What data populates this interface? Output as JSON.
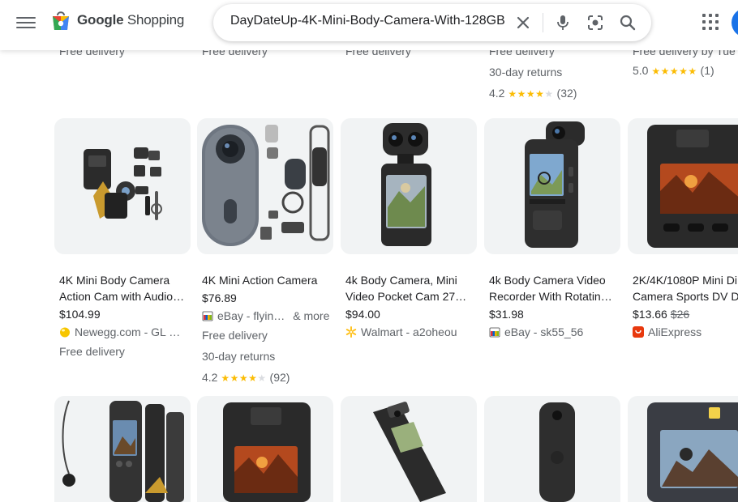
{
  "header": {
    "logo_word1": "Google",
    "logo_word2": "Shopping",
    "search_value": "DayDateUp-4K-Mini-Body-Camera-With-128GB",
    "icons": [
      "menu-icon",
      "shopping-bag-logo",
      "close-icon",
      "mic-icon",
      "lens-icon",
      "search-icon",
      "apps-grid-icon",
      "avatar"
    ]
  },
  "top_row": [
    {
      "line1": "Free delivery"
    },
    {
      "line1": "Free delivery"
    },
    {
      "line1": "Free delivery"
    },
    {
      "line1": "Free delivery",
      "line2": "30-day returns",
      "rating": "4.2",
      "stars": "★★★★",
      "star_empty": "★",
      "reviews": "(32)"
    },
    {
      "line1": "Free delivery by Tue",
      "rating": "5.0",
      "stars": "★★★★★",
      "reviews": "(1)"
    }
  ],
  "products": [
    {
      "title_l1": "4K Mini Body Camera",
      "title_l2": "Action Cam with Audio…",
      "price": "$104.99",
      "store": "Newegg.com - GL …",
      "store_icon": "newegg-icon",
      "extra1": "Free delivery"
    },
    {
      "title_l1": "4K Mini Action Camera",
      "title_l2": "",
      "price": "$76.89",
      "store": "eBay - flyin…",
      "store_icon": "ebay-icon",
      "more": "& more",
      "extra1": "Free delivery",
      "extra2": "30-day returns",
      "rating": "4.2",
      "stars": "★★★★",
      "star_empty": "★",
      "reviews": "(92)"
    },
    {
      "title_l1": "4k Body Camera, Mini",
      "title_l2": "Video Pocket Cam 27…",
      "price": "$94.00",
      "store": "Walmart - a2oheou",
      "store_icon": "walmart-icon"
    },
    {
      "title_l1": "4k Body Camera Video",
      "title_l2": "Recorder With Rotatin…",
      "price": "$31.98",
      "store": "eBay - sk55_56",
      "store_icon": "ebay-icon"
    },
    {
      "title_l1": "2K/4K/1080P Mini Di",
      "title_l2": "Camera Sports DV D",
      "price": "$13.66",
      "old_price": "$26",
      "store": "AliExpress",
      "store_icon": "aliexpress-icon"
    }
  ],
  "colors": {
    "star": "#fbbc04",
    "text": "#202124",
    "muted": "#5f6368",
    "card_bg": "#f1f3f4"
  }
}
